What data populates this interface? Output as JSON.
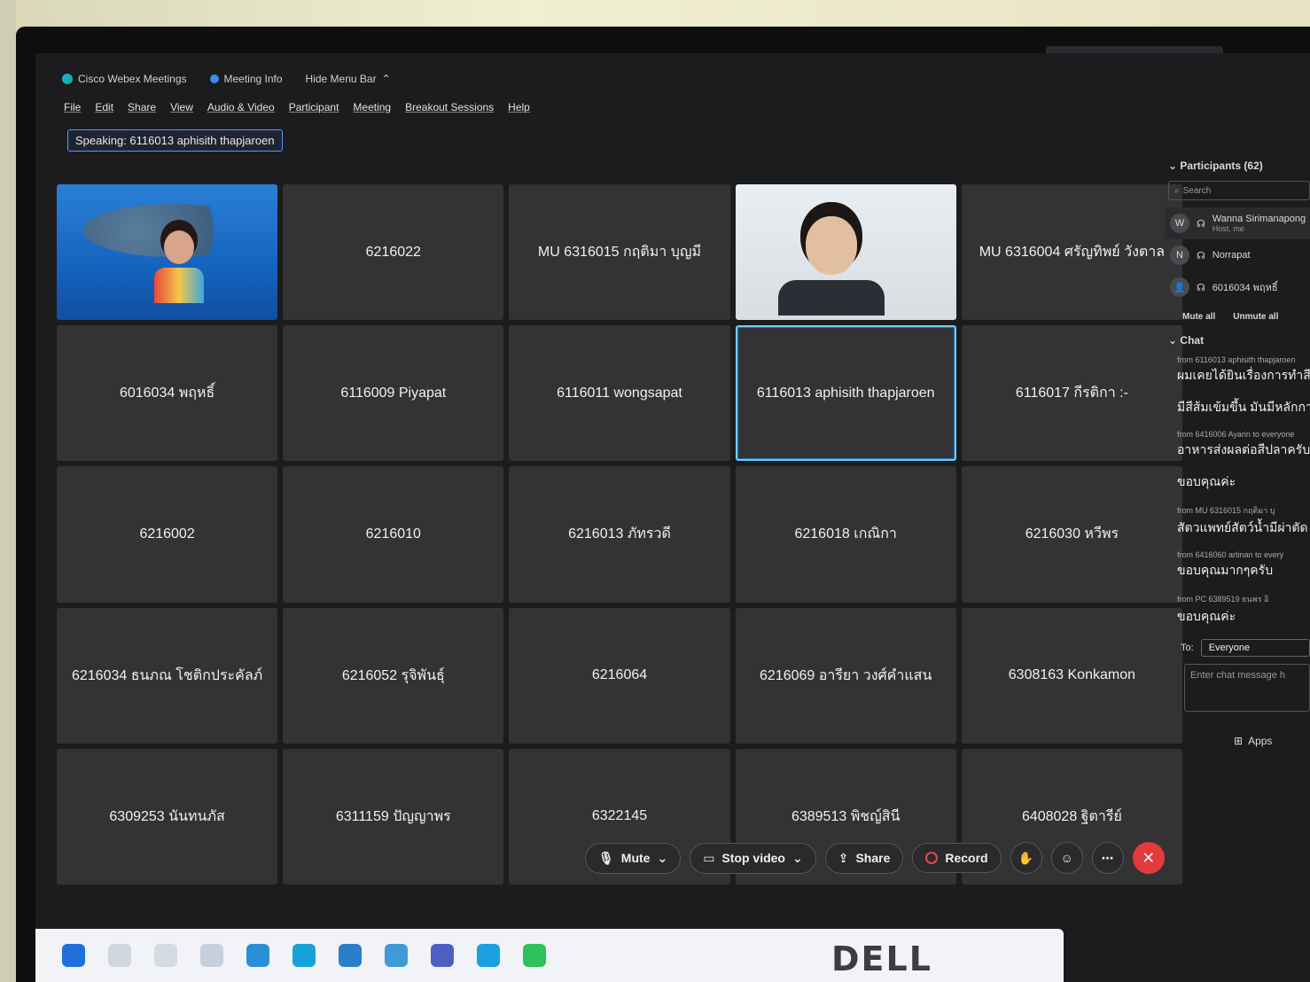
{
  "titlebar": {
    "app_name": "Cisco Webex Meetings",
    "meeting_info": "Meeting Info",
    "hide_menu": "Hide Menu Bar"
  },
  "menu": [
    "File",
    "Edit",
    "Share",
    "View",
    "Audio & Video",
    "Participant",
    "Meeting",
    "Breakout Sessions",
    "Help"
  ],
  "speaking": "Speaking: 6116013 aphisith thapjaroen",
  "tiles": [
    {
      "label": "",
      "kind": "video-ocean"
    },
    {
      "label": "6216022"
    },
    {
      "label": "MU 6316015 กฤติมา บุญมี"
    },
    {
      "label": "",
      "kind": "video-room"
    },
    {
      "label": "MU 6316004 ศรัญทิพย์ วังตาล"
    },
    {
      "label": "6016034 พฤหธิ์"
    },
    {
      "label": "6116009 Piyapat"
    },
    {
      "label": "6116011 wongsapat"
    },
    {
      "label": "6116013 aphisith thapjaroen",
      "active": true
    },
    {
      "label": "6116017 กีรติกา :-"
    },
    {
      "label": "6216002"
    },
    {
      "label": "6216010"
    },
    {
      "label": "6216013 ภัทรวดี"
    },
    {
      "label": "6216018 เกณิกา"
    },
    {
      "label": "6216030 หวีพร"
    },
    {
      "label": "6216034 ธนภณ โชติกประคัลภ์"
    },
    {
      "label": "6216052 รุจิพันธุ์"
    },
    {
      "label": "6216064"
    },
    {
      "label": "6216069 อารียา วงศ์คำแสน"
    },
    {
      "label": "6308163 Konkamon"
    },
    {
      "label": "6309253 นันทนภัส"
    },
    {
      "label": "6311159 ปัญญาพร"
    },
    {
      "label": "6322145"
    },
    {
      "label": "6389513 พิชญ์สินี"
    },
    {
      "label": "6408028 ฐิตารีย์"
    }
  ],
  "participants": {
    "header": "Participants (62)",
    "search_placeholder": "Search",
    "list": [
      {
        "name": "Wanna Sirimanapong",
        "sub": "Host, me"
      },
      {
        "name": "Norrapat",
        "sub": ""
      },
      {
        "name": "6016034 พฤหธิ์",
        "sub": ""
      }
    ],
    "mute_all": "Mute all",
    "unmute_all": "Unmute all"
  },
  "chat": {
    "header": "Chat",
    "messages": [
      {
        "from": "from 6116013 aphisith thapjaroen",
        "text": "ผมเคยได้ยินเรื่องการทำสี"
      },
      {
        "from": "",
        "text": "มีสีส้มเข้มขึ้น มันมีหลักการ"
      },
      {
        "from": "from 6416006 Ayarin to everyone",
        "text": "อาหารส่งผลต่อสีปลาครับ"
      },
      {
        "from": "",
        "text": "ขอบคุณค่ะ"
      },
      {
        "from": "from MU 6316015 กฤติมา บุ",
        "text": "สัตวแพทย์สัตว์น้ำมีผ่าตัด"
      },
      {
        "from": "from 6416060 artinan to every",
        "text": "ขอบคุณมากๆครับ"
      },
      {
        "from": "from PC 6389519 ธนพร อิ",
        "text": "ขอบคุณค่ะ"
      }
    ],
    "to_label": "To:",
    "to_value": "Everyone",
    "input_placeholder": "Enter chat message h",
    "apps": "Apps"
  },
  "toolbar": {
    "mute": "Mute",
    "stop_video": "Stop video",
    "share": "Share",
    "record": "Record",
    "end_color": "#e23b3b"
  },
  "hardware": {
    "brand": "DELL"
  }
}
